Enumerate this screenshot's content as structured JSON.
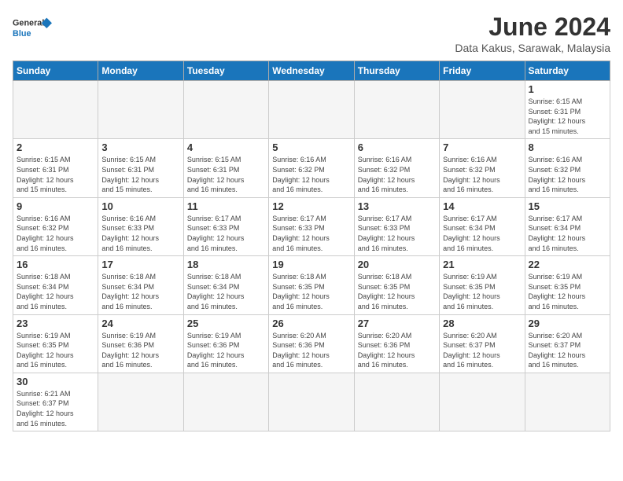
{
  "logo": {
    "text_general": "General",
    "text_blue": "Blue"
  },
  "title": "June 2024",
  "subtitle": "Data Kakus, Sarawak, Malaysia",
  "headers": [
    "Sunday",
    "Monday",
    "Tuesday",
    "Wednesday",
    "Thursday",
    "Friday",
    "Saturday"
  ],
  "weeks": [
    [
      {
        "day": "",
        "info": ""
      },
      {
        "day": "",
        "info": ""
      },
      {
        "day": "",
        "info": ""
      },
      {
        "day": "",
        "info": ""
      },
      {
        "day": "",
        "info": ""
      },
      {
        "day": "",
        "info": ""
      },
      {
        "day": "1",
        "info": "Sunrise: 6:15 AM\nSunset: 6:31 PM\nDaylight: 12 hours\nand 15 minutes."
      }
    ],
    [
      {
        "day": "2",
        "info": "Sunrise: 6:15 AM\nSunset: 6:31 PM\nDaylight: 12 hours\nand 15 minutes."
      },
      {
        "day": "3",
        "info": "Sunrise: 6:15 AM\nSunset: 6:31 PM\nDaylight: 12 hours\nand 15 minutes."
      },
      {
        "day": "4",
        "info": "Sunrise: 6:15 AM\nSunset: 6:31 PM\nDaylight: 12 hours\nand 16 minutes."
      },
      {
        "day": "5",
        "info": "Sunrise: 6:16 AM\nSunset: 6:32 PM\nDaylight: 12 hours\nand 16 minutes."
      },
      {
        "day": "6",
        "info": "Sunrise: 6:16 AM\nSunset: 6:32 PM\nDaylight: 12 hours\nand 16 minutes."
      },
      {
        "day": "7",
        "info": "Sunrise: 6:16 AM\nSunset: 6:32 PM\nDaylight: 12 hours\nand 16 minutes."
      },
      {
        "day": "8",
        "info": "Sunrise: 6:16 AM\nSunset: 6:32 PM\nDaylight: 12 hours\nand 16 minutes."
      }
    ],
    [
      {
        "day": "9",
        "info": "Sunrise: 6:16 AM\nSunset: 6:32 PM\nDaylight: 12 hours\nand 16 minutes."
      },
      {
        "day": "10",
        "info": "Sunrise: 6:16 AM\nSunset: 6:33 PM\nDaylight: 12 hours\nand 16 minutes."
      },
      {
        "day": "11",
        "info": "Sunrise: 6:17 AM\nSunset: 6:33 PM\nDaylight: 12 hours\nand 16 minutes."
      },
      {
        "day": "12",
        "info": "Sunrise: 6:17 AM\nSunset: 6:33 PM\nDaylight: 12 hours\nand 16 minutes."
      },
      {
        "day": "13",
        "info": "Sunrise: 6:17 AM\nSunset: 6:33 PM\nDaylight: 12 hours\nand 16 minutes."
      },
      {
        "day": "14",
        "info": "Sunrise: 6:17 AM\nSunset: 6:34 PM\nDaylight: 12 hours\nand 16 minutes."
      },
      {
        "day": "15",
        "info": "Sunrise: 6:17 AM\nSunset: 6:34 PM\nDaylight: 12 hours\nand 16 minutes."
      }
    ],
    [
      {
        "day": "16",
        "info": "Sunrise: 6:18 AM\nSunset: 6:34 PM\nDaylight: 12 hours\nand 16 minutes."
      },
      {
        "day": "17",
        "info": "Sunrise: 6:18 AM\nSunset: 6:34 PM\nDaylight: 12 hours\nand 16 minutes."
      },
      {
        "day": "18",
        "info": "Sunrise: 6:18 AM\nSunset: 6:34 PM\nDaylight: 12 hours\nand 16 minutes."
      },
      {
        "day": "19",
        "info": "Sunrise: 6:18 AM\nSunset: 6:35 PM\nDaylight: 12 hours\nand 16 minutes."
      },
      {
        "day": "20",
        "info": "Sunrise: 6:18 AM\nSunset: 6:35 PM\nDaylight: 12 hours\nand 16 minutes."
      },
      {
        "day": "21",
        "info": "Sunrise: 6:19 AM\nSunset: 6:35 PM\nDaylight: 12 hours\nand 16 minutes."
      },
      {
        "day": "22",
        "info": "Sunrise: 6:19 AM\nSunset: 6:35 PM\nDaylight: 12 hours\nand 16 minutes."
      }
    ],
    [
      {
        "day": "23",
        "info": "Sunrise: 6:19 AM\nSunset: 6:35 PM\nDaylight: 12 hours\nand 16 minutes."
      },
      {
        "day": "24",
        "info": "Sunrise: 6:19 AM\nSunset: 6:36 PM\nDaylight: 12 hours\nand 16 minutes."
      },
      {
        "day": "25",
        "info": "Sunrise: 6:19 AM\nSunset: 6:36 PM\nDaylight: 12 hours\nand 16 minutes."
      },
      {
        "day": "26",
        "info": "Sunrise: 6:20 AM\nSunset: 6:36 PM\nDaylight: 12 hours\nand 16 minutes."
      },
      {
        "day": "27",
        "info": "Sunrise: 6:20 AM\nSunset: 6:36 PM\nDaylight: 12 hours\nand 16 minutes."
      },
      {
        "day": "28",
        "info": "Sunrise: 6:20 AM\nSunset: 6:37 PM\nDaylight: 12 hours\nand 16 minutes."
      },
      {
        "day": "29",
        "info": "Sunrise: 6:20 AM\nSunset: 6:37 PM\nDaylight: 12 hours\nand 16 minutes."
      }
    ],
    [
      {
        "day": "30",
        "info": "Sunrise: 6:21 AM\nSunset: 6:37 PM\nDaylight: 12 hours\nand 16 minutes."
      },
      {
        "day": "",
        "info": ""
      },
      {
        "day": "",
        "info": ""
      },
      {
        "day": "",
        "info": ""
      },
      {
        "day": "",
        "info": ""
      },
      {
        "day": "",
        "info": ""
      },
      {
        "day": "",
        "info": ""
      }
    ]
  ]
}
